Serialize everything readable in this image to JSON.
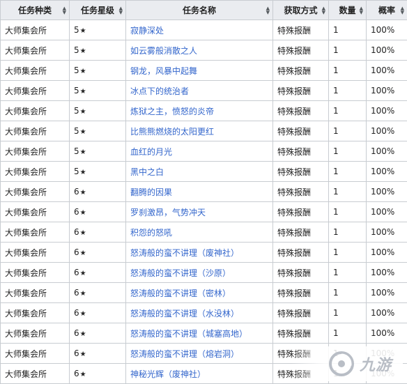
{
  "table": {
    "headers": [
      "任务种类",
      "任务星级",
      "任务名称",
      "获取方式",
      "数量",
      "概率"
    ],
    "rows": [
      {
        "type": "大师集会所",
        "star": "5",
        "name": "寂静深处",
        "method": "特殊报酬",
        "qty": "1",
        "rate": "100%"
      },
      {
        "type": "大师集会所",
        "star": "5",
        "name": "如云雾般消散之人",
        "method": "特殊报酬",
        "qty": "1",
        "rate": "100%"
      },
      {
        "type": "大师集会所",
        "star": "5",
        "name": "钢龙，风暴中起舞",
        "method": "特殊报酬",
        "qty": "1",
        "rate": "100%"
      },
      {
        "type": "大师集会所",
        "star": "5",
        "name": "冰点下的统治者",
        "method": "特殊报酬",
        "qty": "1",
        "rate": "100%"
      },
      {
        "type": "大师集会所",
        "star": "5",
        "name": "炼狱之主，愤怒的炎帝",
        "method": "特殊报酬",
        "qty": "1",
        "rate": "100%"
      },
      {
        "type": "大师集会所",
        "star": "5",
        "name": "比熊熊燃烧的太阳更红",
        "method": "特殊报酬",
        "qty": "1",
        "rate": "100%"
      },
      {
        "type": "大师集会所",
        "star": "5",
        "name": "血红的月光",
        "method": "特殊报酬",
        "qty": "1",
        "rate": "100%"
      },
      {
        "type": "大师集会所",
        "star": "5",
        "name": "黑中之白",
        "method": "特殊报酬",
        "qty": "1",
        "rate": "100%"
      },
      {
        "type": "大师集会所",
        "star": "6",
        "name": "翻腾的因果",
        "method": "特殊报酬",
        "qty": "1",
        "rate": "100%"
      },
      {
        "type": "大师集会所",
        "star": "6",
        "name": "罗刹激昂，气势冲天",
        "method": "特殊报酬",
        "qty": "1",
        "rate": "100%"
      },
      {
        "type": "大师集会所",
        "star": "6",
        "name": "积怨的怒吼",
        "method": "特殊报酬",
        "qty": "1",
        "rate": "100%"
      },
      {
        "type": "大师集会所",
        "star": "6",
        "name": "怒涛般的蛮不讲理（废神社）",
        "method": "特殊报酬",
        "qty": "1",
        "rate": "100%"
      },
      {
        "type": "大师集会所",
        "star": "6",
        "name": "怒涛般的蛮不讲理（沙原）",
        "method": "特殊报酬",
        "qty": "1",
        "rate": "100%"
      },
      {
        "type": "大师集会所",
        "star": "6",
        "name": "怒涛般的蛮不讲理（密林）",
        "method": "特殊报酬",
        "qty": "1",
        "rate": "100%"
      },
      {
        "type": "大师集会所",
        "star": "6",
        "name": "怒涛般的蛮不讲理（水没林）",
        "method": "特殊报酬",
        "qty": "1",
        "rate": "100%"
      },
      {
        "type": "大师集会所",
        "star": "6",
        "name": "怒涛般的蛮不讲理（城塞高地）",
        "method": "特殊报酬",
        "qty": "1",
        "rate": "100%"
      },
      {
        "type": "大师集会所",
        "star": "6",
        "name": "怒涛般的蛮不讲理（熔岩洞）",
        "method": "特殊报酬",
        "qty": "1",
        "rate": "100%"
      },
      {
        "type": "大师集会所",
        "star": "6",
        "name": "神秘光辉（废神社）",
        "method": "特殊报酬",
        "qty": "1",
        "rate": "100%"
      }
    ],
    "star_glyph": "★",
    "sort_icon": "sort-arrows-icon"
  },
  "watermark": {
    "text": "九游",
    "logo_icon": "jiuyou-logo-icon"
  },
  "colors": {
    "link": "#3366cc",
    "header_bg": "#eaecf0",
    "border": "#c8ccd1"
  }
}
